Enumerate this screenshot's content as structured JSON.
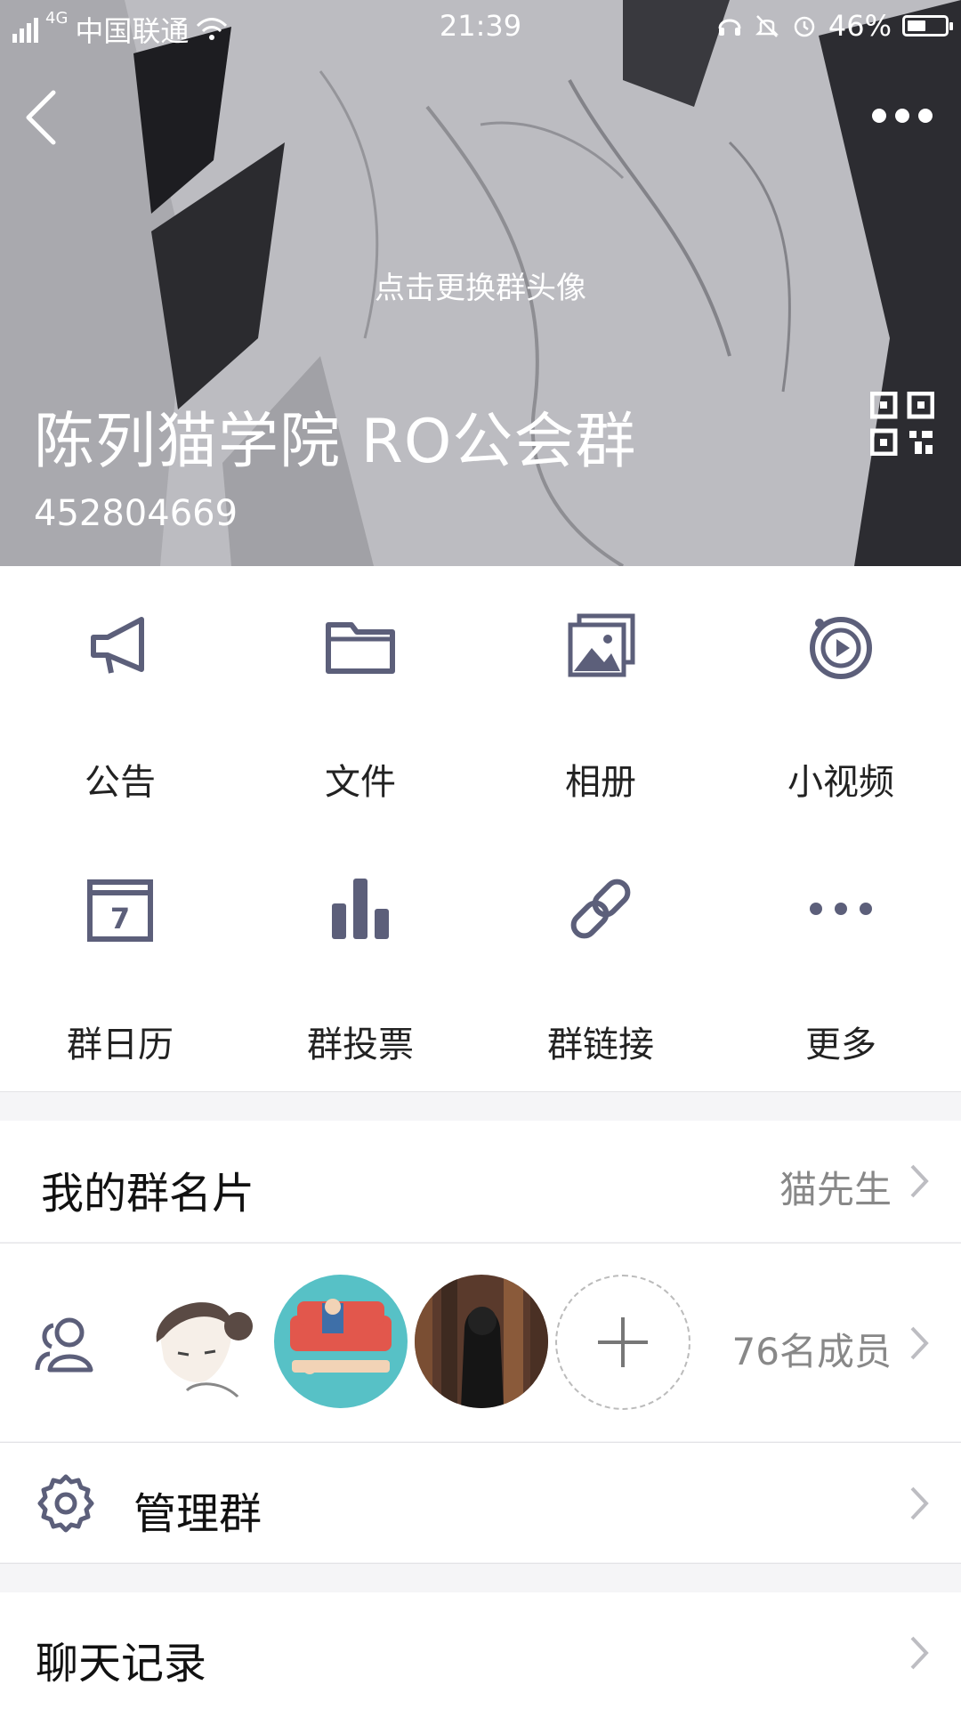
{
  "status_bar": {
    "carrier": "中国联通",
    "network": "4G",
    "time": "21:39",
    "battery": "46%"
  },
  "header": {
    "change_avatar_hint": "点击更换群头像",
    "group_name": "陈列猫学院 RO公会群",
    "group_id": "452804669"
  },
  "features": [
    {
      "label": "公告",
      "icon": "megaphone-icon"
    },
    {
      "label": "文件",
      "icon": "folder-icon"
    },
    {
      "label": "相册",
      "icon": "photo-album-icon"
    },
    {
      "label": "小视频",
      "icon": "video-icon"
    },
    {
      "label": "群日历",
      "icon": "calendar-icon"
    },
    {
      "label": "群投票",
      "icon": "bar-chart-icon"
    },
    {
      "label": "群链接",
      "icon": "link-icon"
    },
    {
      "label": "更多",
      "icon": "more-icon"
    }
  ],
  "calendar_day": "7",
  "my_card": {
    "title": "我的群名片",
    "value": "猫先生"
  },
  "members": {
    "count_label": "76名成员"
  },
  "manage": {
    "title": "管理群"
  },
  "chat_history": {
    "title": "聊天记录"
  },
  "colors": {
    "icon": "#5c5f7a",
    "text": "#222222",
    "secondary": "#888888"
  }
}
